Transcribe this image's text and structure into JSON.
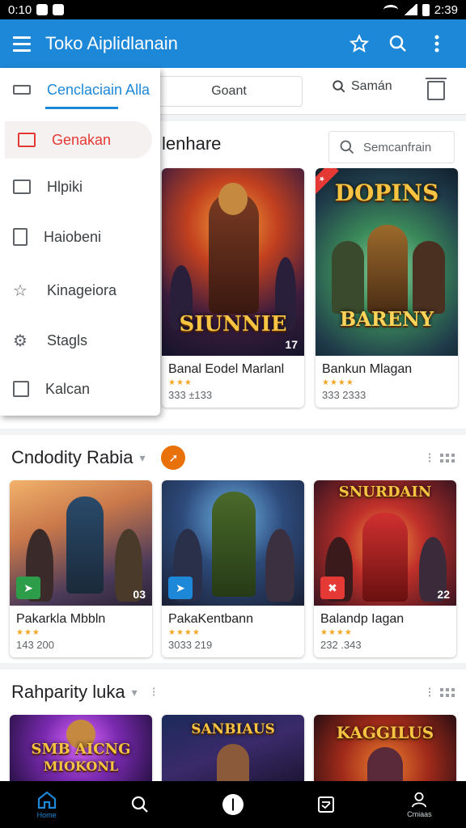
{
  "status_bar": {
    "time": "0:10",
    "clock": "2:39"
  },
  "app_bar": {
    "title": "Toko Aiplidlanain",
    "star_icon": "star-icon",
    "search_icon": "search-icon",
    "more_icon": "more-vert-icon"
  },
  "top_row": {
    "chip_label": "Goant",
    "search_label": "Samán"
  },
  "drawer": {
    "header": "Cenclaciain Alla",
    "items": [
      {
        "label": "Genakan",
        "icon": "inbox-icon",
        "active": true
      },
      {
        "label": "Hlpiki",
        "icon": "image-icon"
      },
      {
        "label": "Haiobeni",
        "icon": "bookmark-icon"
      },
      {
        "label": "Kinageiora",
        "icon": "star-outline-icon"
      },
      {
        "label": "Stagls",
        "icon": "gear-icon"
      },
      {
        "label": "Kalcan",
        "icon": "folder-icon"
      }
    ]
  },
  "section1": {
    "title": "lenhare",
    "search_placeholder": "Semcanfrain",
    "cards": [
      {
        "title": "Banal Eodel Marlanl",
        "meta": "333 ±133",
        "art": "SIUNNIE",
        "corner": "17"
      },
      {
        "title": "Bankun Mlagan",
        "meta": "333 2333",
        "art": "DOPINS",
        "art2": "BARENY"
      }
    ]
  },
  "section2": {
    "title": "Cndodity Rabia",
    "cards": [
      {
        "title": "Pakarkla Mbbln",
        "meta": "143 200",
        "corner": "03"
      },
      {
        "title": "PakaKentbann",
        "meta": "3033 219"
      },
      {
        "title": "Balandp Iagan",
        "meta": "232 .343",
        "art": "SNURDAIN",
        "corner": "22"
      }
    ]
  },
  "section3": {
    "title": "Rahparity luka",
    "cards": [
      {
        "art": "SMB AICNG",
        "art2": "MIOKONL"
      },
      {
        "art": "SANBIAUS"
      },
      {
        "art": "KAGGILUS"
      }
    ]
  },
  "bottom_nav": {
    "items": [
      {
        "label": "Home",
        "icon": "home-icon",
        "active": true
      },
      {
        "label": "",
        "icon": "search-icon"
      },
      {
        "label": "",
        "icon": "info-icon"
      },
      {
        "label": "",
        "icon": "library-icon"
      },
      {
        "label": "Cmiaas",
        "icon": "person-icon"
      }
    ]
  },
  "colors": {
    "primary": "#1e88d8",
    "accent_red": "#e53935",
    "star": "#f5a623",
    "orange": "#e8710a"
  }
}
